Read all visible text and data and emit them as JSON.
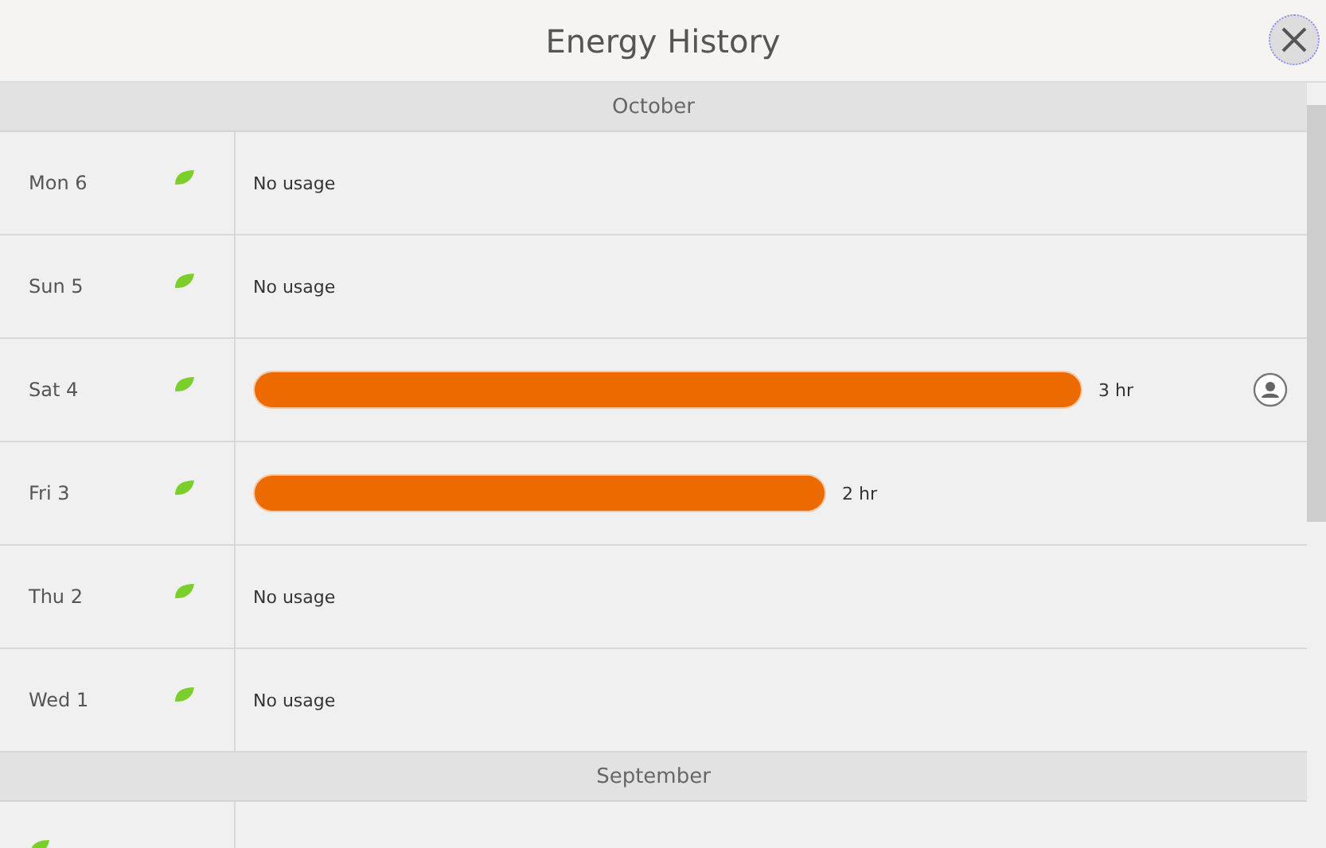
{
  "window": {
    "title": "Energy History"
  },
  "months": [
    {
      "name": "October",
      "days": [
        {
          "label": "Mon 6",
          "kind": "none",
          "text": "No usage",
          "user": false
        },
        {
          "label": "Sun 5",
          "kind": "none",
          "text": "No usage",
          "user": false
        },
        {
          "label": "Sat 4",
          "kind": "bar",
          "reading": "3 hr",
          "user": true
        },
        {
          "label": "Fri 3",
          "kind": "bar",
          "reading": "2 hr",
          "user": false
        },
        {
          "label": "Thu 2",
          "kind": "none",
          "text": "No usage",
          "user": false
        },
        {
          "label": "Wed 1",
          "kind": "none",
          "text": "No usage",
          "user": false
        }
      ]
    },
    {
      "name": "September",
      "days": [
        {
          "kind": "partial"
        }
      ]
    }
  ]
}
